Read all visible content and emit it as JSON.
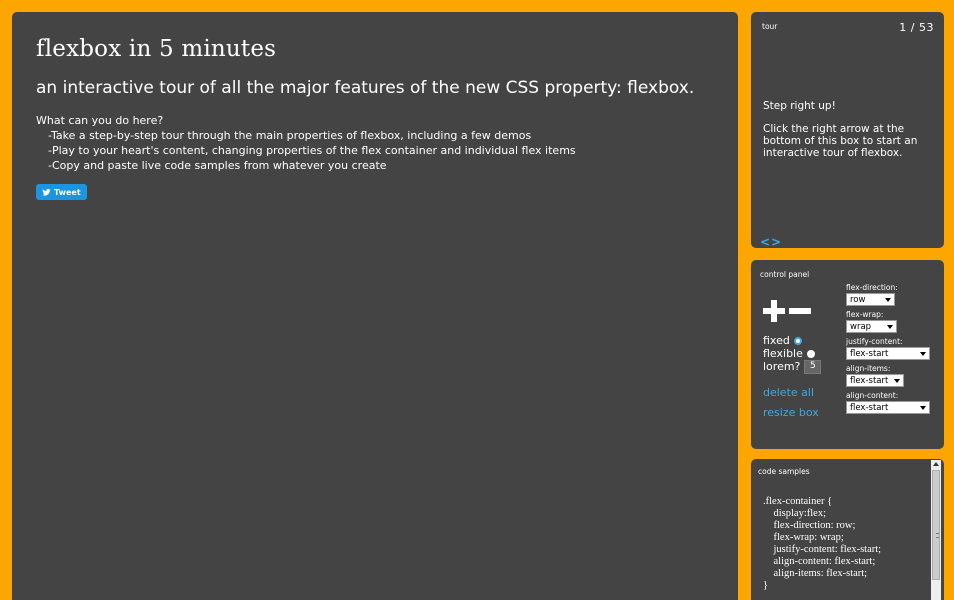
{
  "main": {
    "title": "flexbox in 5 minutes",
    "subtitle": "an interactive tour of all the major features of the new CSS property: flexbox.",
    "question": "What can you do here?",
    "bullets": [
      "-Take a step-by-step tour through the main properties of flexbox, including a few demos",
      "-Play to your heart's content, changing properties of the flex container and individual flex items",
      "-Copy and paste live code samples from whatever you create"
    ],
    "tweet_label": "Tweet"
  },
  "tour": {
    "title": "tour",
    "counter": "1 / 53",
    "line1": "Step right up!",
    "line2": "Click the right arrow at the bottom of this box to start an interactive tour of flexbox.",
    "prev": "<",
    "next": ">"
  },
  "control": {
    "title": "control panel",
    "fixed_label": "fixed",
    "flexible_label": "flexible",
    "lorem_label": "lorem?",
    "lorem_value": "5",
    "delete_all": "delete all",
    "resize_box": "resize box",
    "props": [
      {
        "label": "flex-direction:",
        "value": "row"
      },
      {
        "label": "flex-wrap:",
        "value": "wrap"
      },
      {
        "label": "justify-content:",
        "value": "flex-start"
      },
      {
        "label": "align-items:",
        "value": "flex-start"
      },
      {
        "label": "align-content:",
        "value": "flex-start"
      }
    ]
  },
  "code": {
    "title": "code samples",
    "sample": ".flex-container {\n    display:flex;\n    flex-direction: row;\n    flex-wrap: wrap;\n    justify-content: flex-start;\n    align-content: flex-start;\n    align-items: flex-start;\n}"
  },
  "colors": {
    "background": "#fea600",
    "panel": "#444444",
    "accent": "#3fa9e4",
    "tweet": "#1b95e0"
  }
}
